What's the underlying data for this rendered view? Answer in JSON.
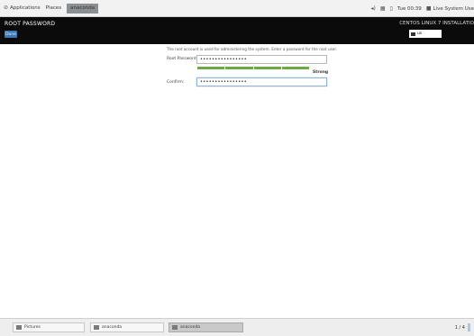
{
  "top_panel": {
    "applications": "Applications",
    "places": "Places",
    "task": "anaconda",
    "clock": "Tue 00:39",
    "user": "Live System Use",
    "icons": [
      "volume-icon",
      "network-icon",
      "battery-icon",
      "power-icon"
    ]
  },
  "header": {
    "spoke_title": "ROOT PASSWORD",
    "done_button": "Done",
    "install_title": "CENTOS LINUX 7 INSTALLATIO",
    "keyboard_layout": "us"
  },
  "form": {
    "intro": "The root account is used for administering the system.  Enter a password for the root user.",
    "root_password_label": "Root Password:",
    "root_password_value": "••••••••••••••••",
    "strength_label": "Strong",
    "strength_level": 1.0,
    "confirm_label": "Confirm:",
    "confirm_value": "••••••••••••••••"
  },
  "bottom_panel": {
    "tasks": [
      "Pictures",
      "anaconda",
      "anaconda"
    ],
    "workspace": "1 / 4"
  },
  "colors": {
    "header_bg": "#0b0b0b",
    "done_button": "#3a78b8",
    "strength_bar": "#6aaa3f"
  }
}
